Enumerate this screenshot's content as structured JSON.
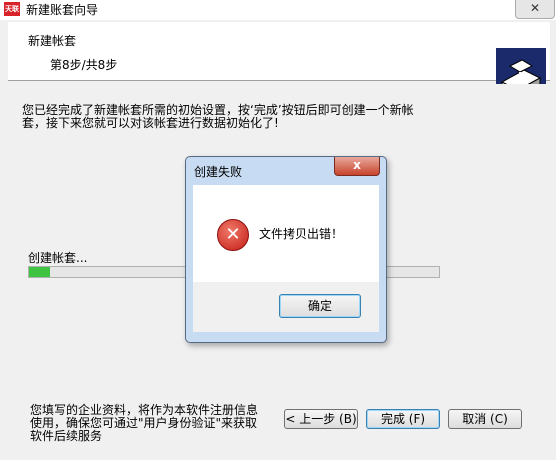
{
  "window": {
    "title": "新建账套向导",
    "logo": "天联",
    "close_glyph": "✕"
  },
  "header": {
    "title": "新建帐套",
    "step": "第8步/共8步",
    "icon": "wizard-install-icon"
  },
  "content": {
    "message": "您已经完成了新建帐套所需的初始设置，按‘完成’按钮后即可创建一个新帐套，接下来您就可以对该帐套进行数据初始化了!",
    "progress_label": "创建帐套...",
    "progress": 0.05
  },
  "footer": {
    "note": "您填写的企业资料，将作为本软件注册信息使用，确保您可通过\"用户身份验证\"来获取软件后续服务",
    "prev_label": "< 上一步 (B)",
    "finish_label": "完成 (F)",
    "cancel_label": "取消 (C)"
  },
  "dialog": {
    "title": "创建失败",
    "close_glyph": "x",
    "icon": "error-icon",
    "error_glyph": "✕",
    "message": "文件拷贝出错！",
    "ok_label": "确定"
  },
  "colors": {
    "progress_fill": "#3fc342",
    "error_red": "#c41c14",
    "dialog_frame": "#c7dcf2"
  }
}
